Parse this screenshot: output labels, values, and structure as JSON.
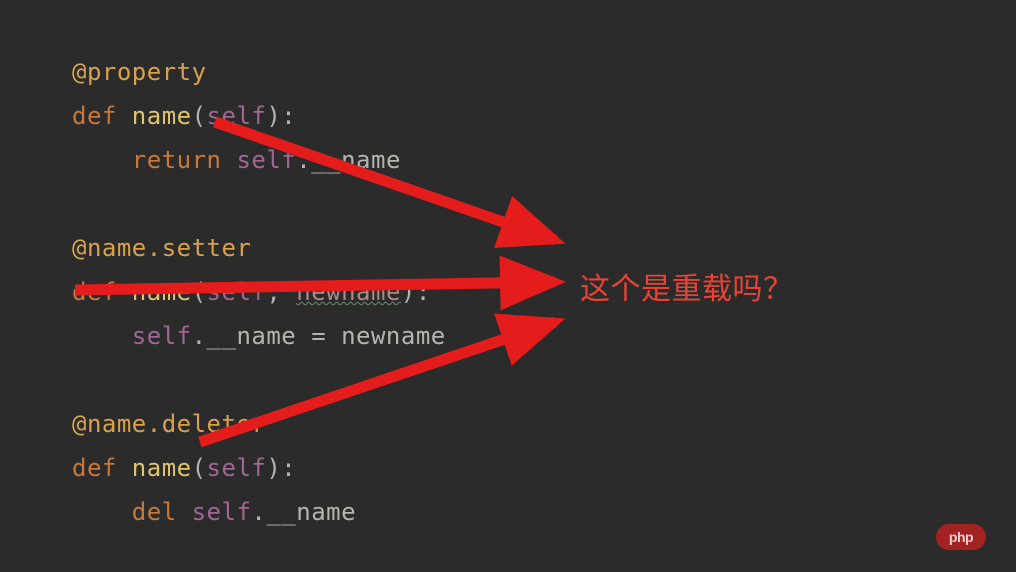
{
  "code": {
    "line1_decorator": "@property",
    "line2_def": "def ",
    "line2_name": "name",
    "line2_open": "(",
    "line2_self": "self",
    "line2_close": "):",
    "line3_indent": "    ",
    "line3_return": "return ",
    "line3_self": "self",
    "line3_rest": ".__name",
    "line5_decorator": "@name.setter",
    "line6_def": "def ",
    "line6_name": "name",
    "line6_open": "(",
    "line6_self": "self",
    "line6_comma": ", ",
    "line6_param": "newname",
    "line6_close": "):",
    "line7_indent": "    ",
    "line7_self": "self",
    "line7_rest": ".__name = newname",
    "line9_decorator": "@name.deleter",
    "line10_def": "def ",
    "line10_name": "name",
    "line10_open": "(",
    "line10_self": "self",
    "line10_close": "):",
    "line11_indent": "    ",
    "line11_del": "del ",
    "line11_self": "self",
    "line11_rest": ".__name"
  },
  "annotation": {
    "text": "这个是重载吗？"
  },
  "watermark": {
    "text": "php"
  }
}
